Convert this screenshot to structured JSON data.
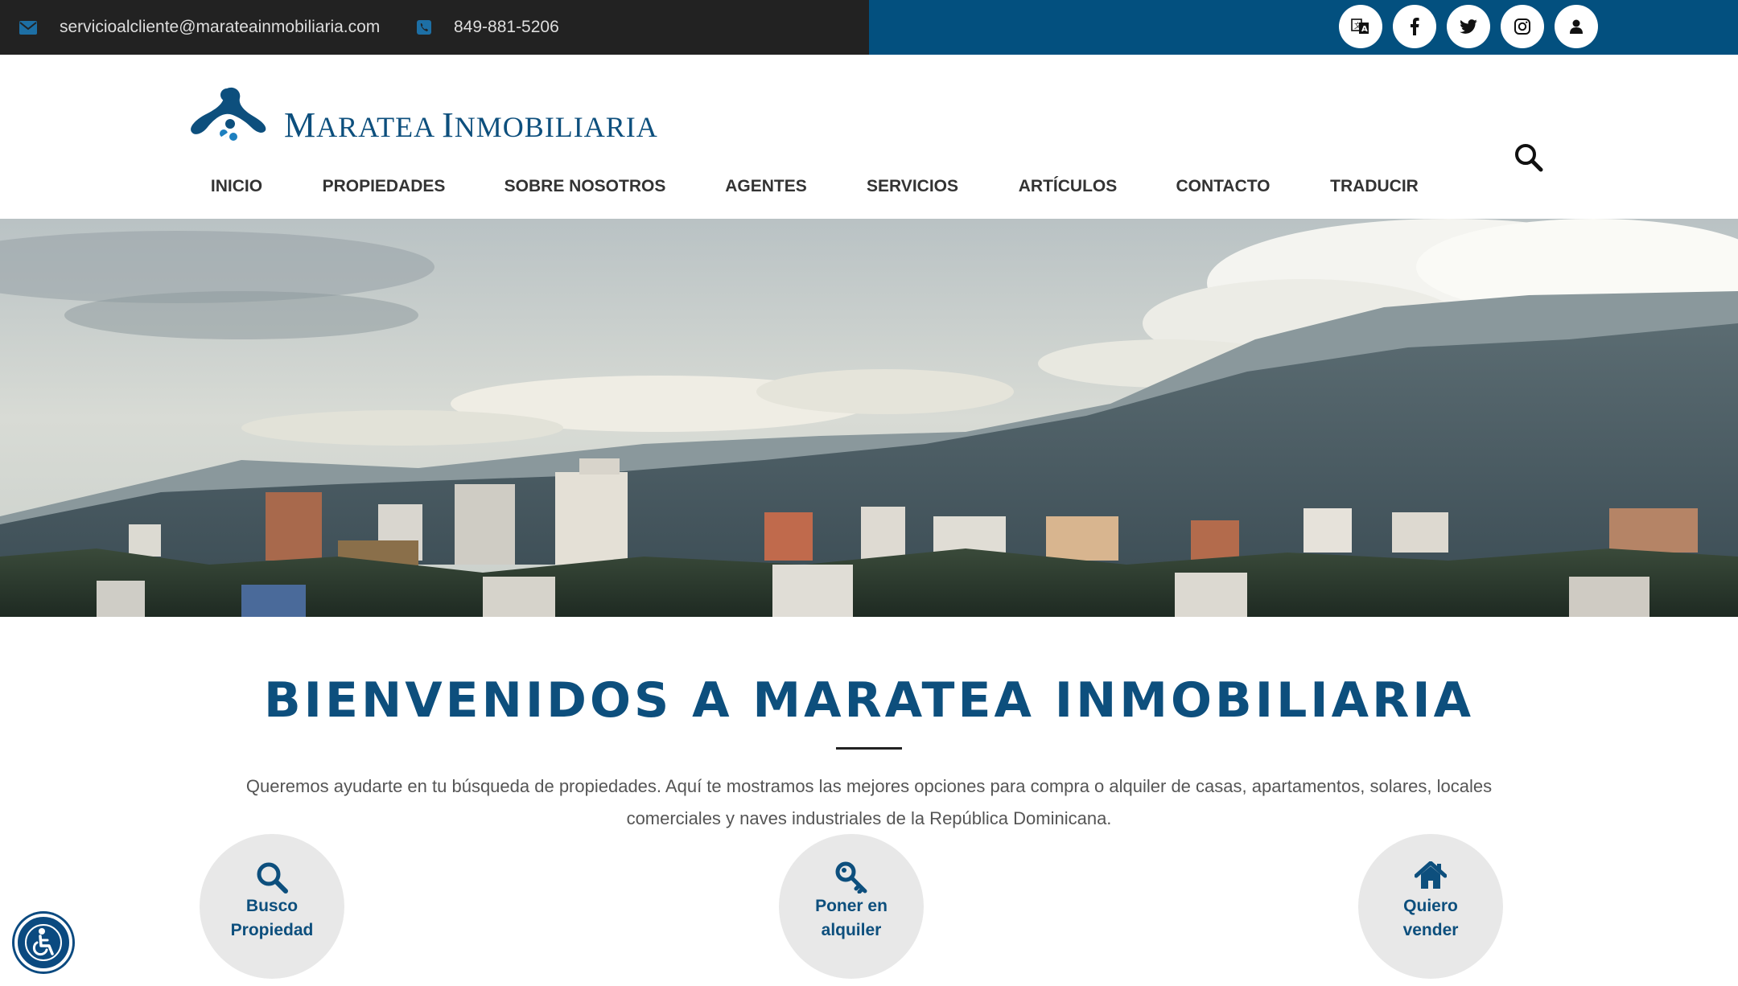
{
  "colors": {
    "brand_blue": "#0d4f7d",
    "topbar_dark": "#222222",
    "topbar_blue": "#03507f",
    "circle_gray": "#e8e8e8"
  },
  "topbar": {
    "email": "servicioalcliente@marateainmobiliaria.com",
    "phone": "849-881-5206",
    "email_icon": "envelope-icon",
    "phone_icon": "phone-icon",
    "social_icons": [
      "translate-icon",
      "facebook-icon",
      "twitter-icon",
      "instagram-icon",
      "user-icon"
    ]
  },
  "header": {
    "logo_text_first": "M",
    "logo_text_rest_1": "ARATEA ",
    "logo_text_second": "I",
    "logo_text_rest_2": "NMOBILIARIA",
    "search_icon": "search-icon"
  },
  "nav": {
    "items": [
      {
        "label": "INICIO"
      },
      {
        "label": "PROPIEDADES"
      },
      {
        "label": "SOBRE NOSOTROS"
      },
      {
        "label": "AGENTES"
      },
      {
        "label": "SERVICIOS"
      },
      {
        "label": "ARTÍCULOS"
      },
      {
        "label": "CONTACTO"
      },
      {
        "label": "TRADUCIR"
      }
    ]
  },
  "welcome": {
    "title": "BIENVENIDOS A MARATEA INMOBILIARIA",
    "intro_line1": "Queremos ayudarte en tu búsqueda de propiedades. Aquí te mostramos las mejores opciones para compra o alquiler de casas, apartamentos, solares, locales",
    "intro_line2": "comerciales y naves industriales de la República Dominicana."
  },
  "services": [
    {
      "icon": "search-icon",
      "line1": "Busco",
      "line2": "Propiedad"
    },
    {
      "icon": "key-icon",
      "line1": "Poner en",
      "line2": "alquiler"
    },
    {
      "icon": "home-icon",
      "line1": "Quiero",
      "line2": "vender"
    }
  ],
  "accessibility": {
    "icon": "accessibility-icon"
  }
}
